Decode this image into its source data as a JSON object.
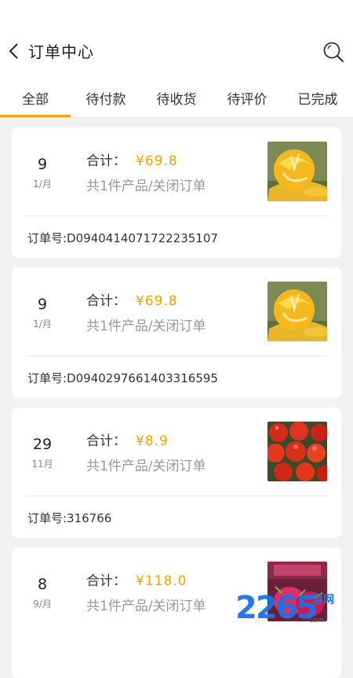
{
  "header": {
    "title": "订单中心",
    "back_icon": "chevron-left-icon",
    "search_icon": "search-icon"
  },
  "tabs": [
    {
      "label": "全部",
      "active": true
    },
    {
      "label": "待付款",
      "active": false
    },
    {
      "label": "待收货",
      "active": false
    },
    {
      "label": "待评价",
      "active": false
    },
    {
      "label": "已完成",
      "active": false
    }
  ],
  "colors": {
    "accent": "#f4a300",
    "background": "#f2f2f2",
    "card": "#ffffff"
  },
  "orders": [
    {
      "day": "9",
      "month": "1/月",
      "total_label": "合计：",
      "price": "¥69.8",
      "summary": "共1件产品/关闭订单",
      "order_no": "订单号:D0940414071722235107",
      "image": "orange"
    },
    {
      "day": "9",
      "month": "1/月",
      "total_label": "合计：",
      "price": "¥69.8",
      "summary": "共1件产品/关闭订单",
      "order_no": "订单号:D0940297661403316595",
      "image": "orange"
    },
    {
      "day": "29",
      "month": "11月",
      "total_label": "合计：",
      "price": "¥8.9",
      "summary": "共1件产品/关闭订单",
      "order_no": "订单号:316766",
      "image": "tomato"
    },
    {
      "day": "8",
      "month": "9/月",
      "total_label": "合计：",
      "price": "¥118.0",
      "summary": "共1件产品/关闭订单",
      "order_no": "",
      "image": "dragonfruit"
    }
  ],
  "watermark": {
    "number": "2265",
    "text": "游网",
    "domain": "com"
  }
}
